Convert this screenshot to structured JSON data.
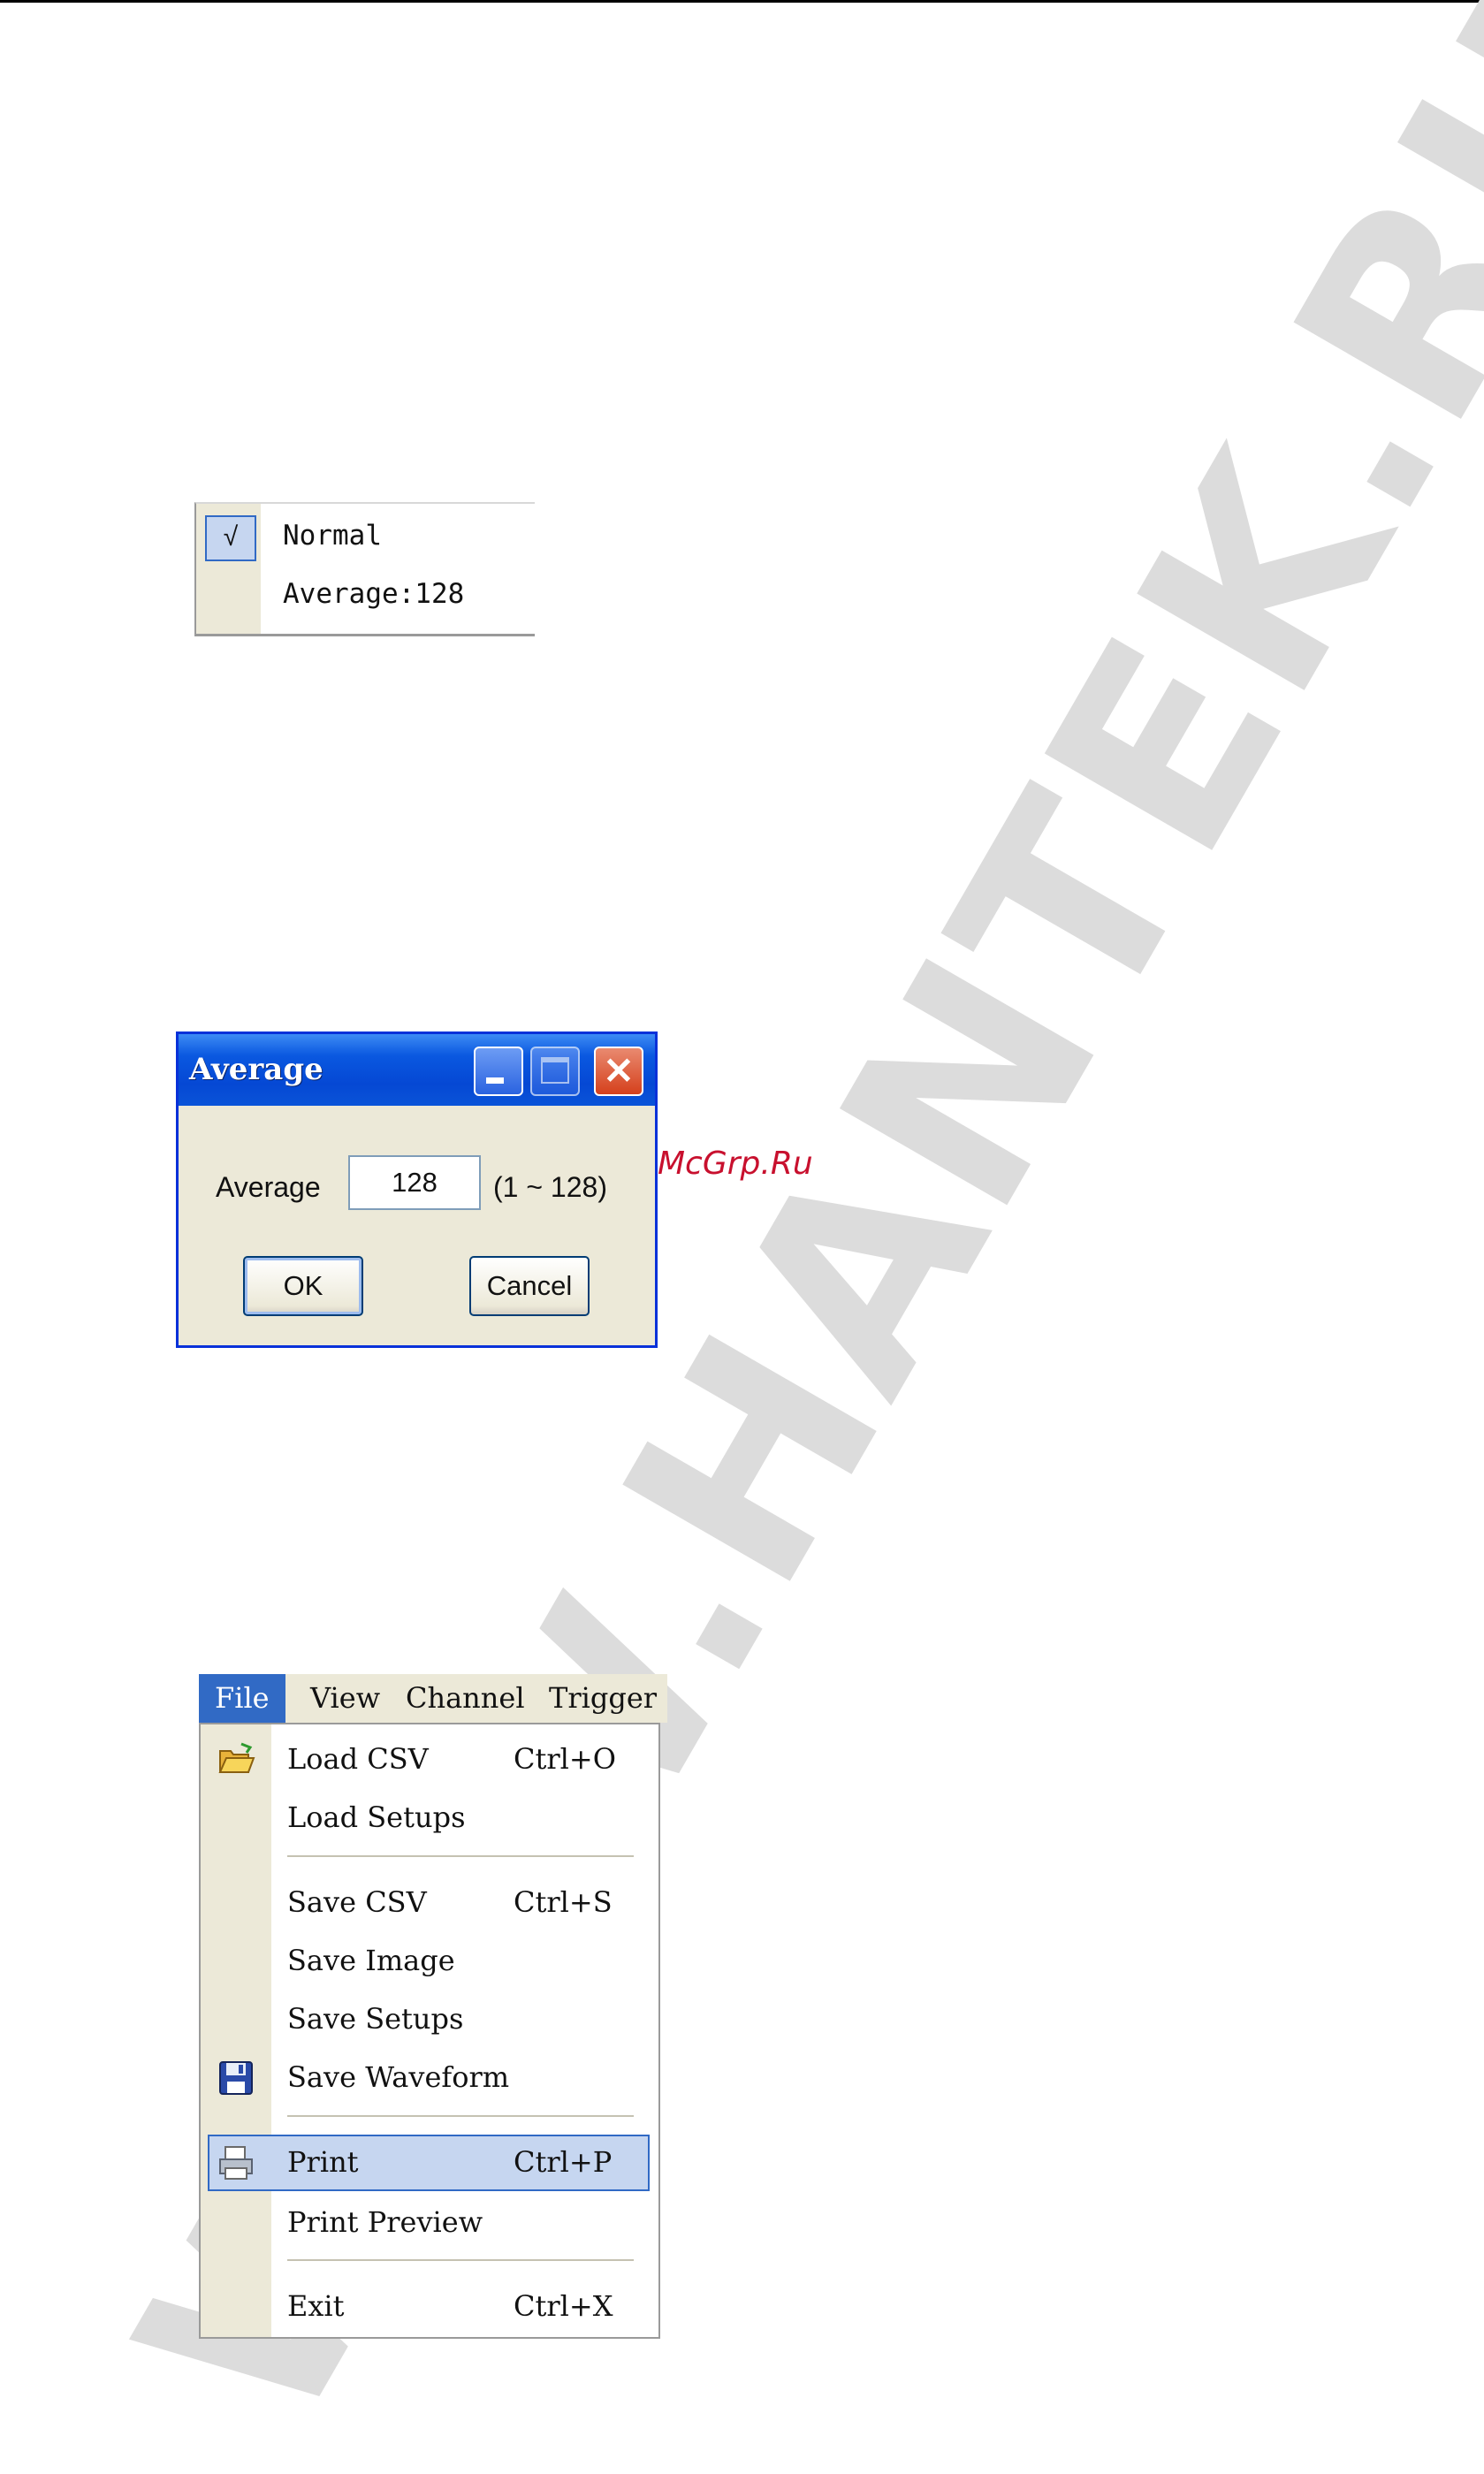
{
  "acquire_menu": {
    "items": [
      {
        "label": "Normal",
        "checked": true,
        "check_mark": "√"
      },
      {
        "label": "Average:128",
        "checked": false
      }
    ]
  },
  "average_dialog": {
    "title": "Average",
    "field_label": "Average",
    "field_value": "128",
    "range_text": "(1 ~ 128)",
    "ok_label": "OK",
    "cancel_label": "Cancel",
    "close_glyph": "✕"
  },
  "menubar": {
    "items": [
      "File",
      "View",
      "Channel",
      "Trigger"
    ]
  },
  "file_menu": {
    "items": [
      {
        "label": "Load CSV",
        "shortcut": "Ctrl+O",
        "icon": "folder-open-icon"
      },
      {
        "label": "Load Setups",
        "shortcut": ""
      },
      {
        "label": "Save CSV",
        "shortcut": "Ctrl+S"
      },
      {
        "label": "Save Image",
        "shortcut": ""
      },
      {
        "label": "Save Setups",
        "shortcut": ""
      },
      {
        "label": "Save Waveform",
        "shortcut": "",
        "icon": "floppy-disk-icon"
      },
      {
        "label": "Print",
        "shortcut": "Ctrl+P",
        "icon": "printer-icon",
        "highlighted": true
      },
      {
        "label": "Print Preview",
        "shortcut": ""
      },
      {
        "label": "Exit",
        "shortcut": "Ctrl+X"
      }
    ]
  },
  "watermark": {
    "text": "WWW.HANTEK.RU",
    "badge": "McGrp.Ru"
  },
  "colors": {
    "selection": "#316ac5",
    "menu_strip": "#ece9d8",
    "xp_title": "#0548d4",
    "badge": "#c8102e"
  }
}
